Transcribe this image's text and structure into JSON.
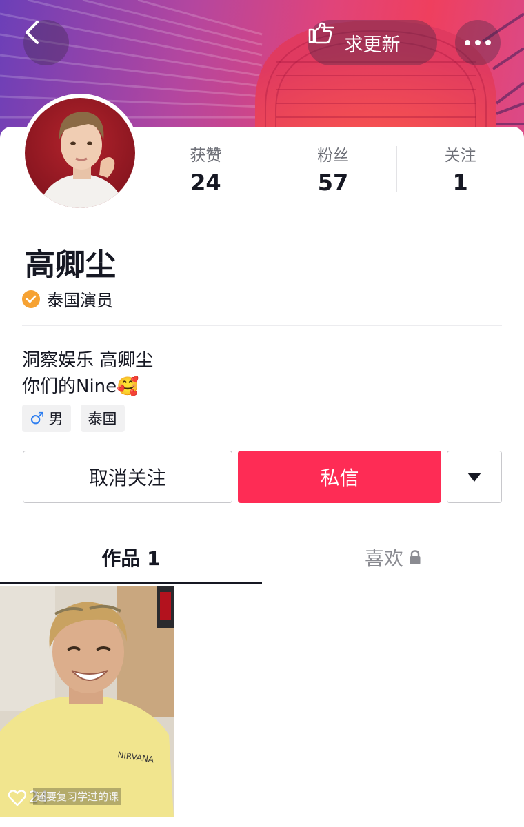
{
  "header": {
    "back_icon": "chevron-left-icon",
    "update_icon": "pointing-hand-icon",
    "update_label": "求更新",
    "more_icon": "more-dots-icon"
  },
  "profile": {
    "name": "高卿尘",
    "verification_label": "泰国演员",
    "verification_icon": "check-badge-icon",
    "stats": [
      {
        "label": "获赞",
        "value": "24"
      },
      {
        "label": "粉丝",
        "value": "57"
      },
      {
        "label": "关注",
        "value": "1"
      }
    ],
    "bio_lines": [
      "洞察娱乐 高卿尘",
      "你们的Nine🥰"
    ],
    "tags": [
      {
        "icon": "male-icon",
        "glyph": "♂",
        "label": "男"
      },
      {
        "label": "泰国"
      }
    ]
  },
  "actions": {
    "unfollow_label": "取消关注",
    "message_label": "私信",
    "dropdown_icon": "triangle-down-icon"
  },
  "tabs": [
    {
      "label": "作品 1",
      "active": true
    },
    {
      "label": "喜欢",
      "icon": "lock-icon",
      "active": false
    }
  ],
  "videos": [
    {
      "likes": "24",
      "caption": "还要复习学过的课",
      "like_icon": "heart-outline-icon"
    }
  ],
  "colors": {
    "accent": "#fe2c55",
    "verify_badge": "#f6a233",
    "male_icon": "#2e7ef0"
  }
}
